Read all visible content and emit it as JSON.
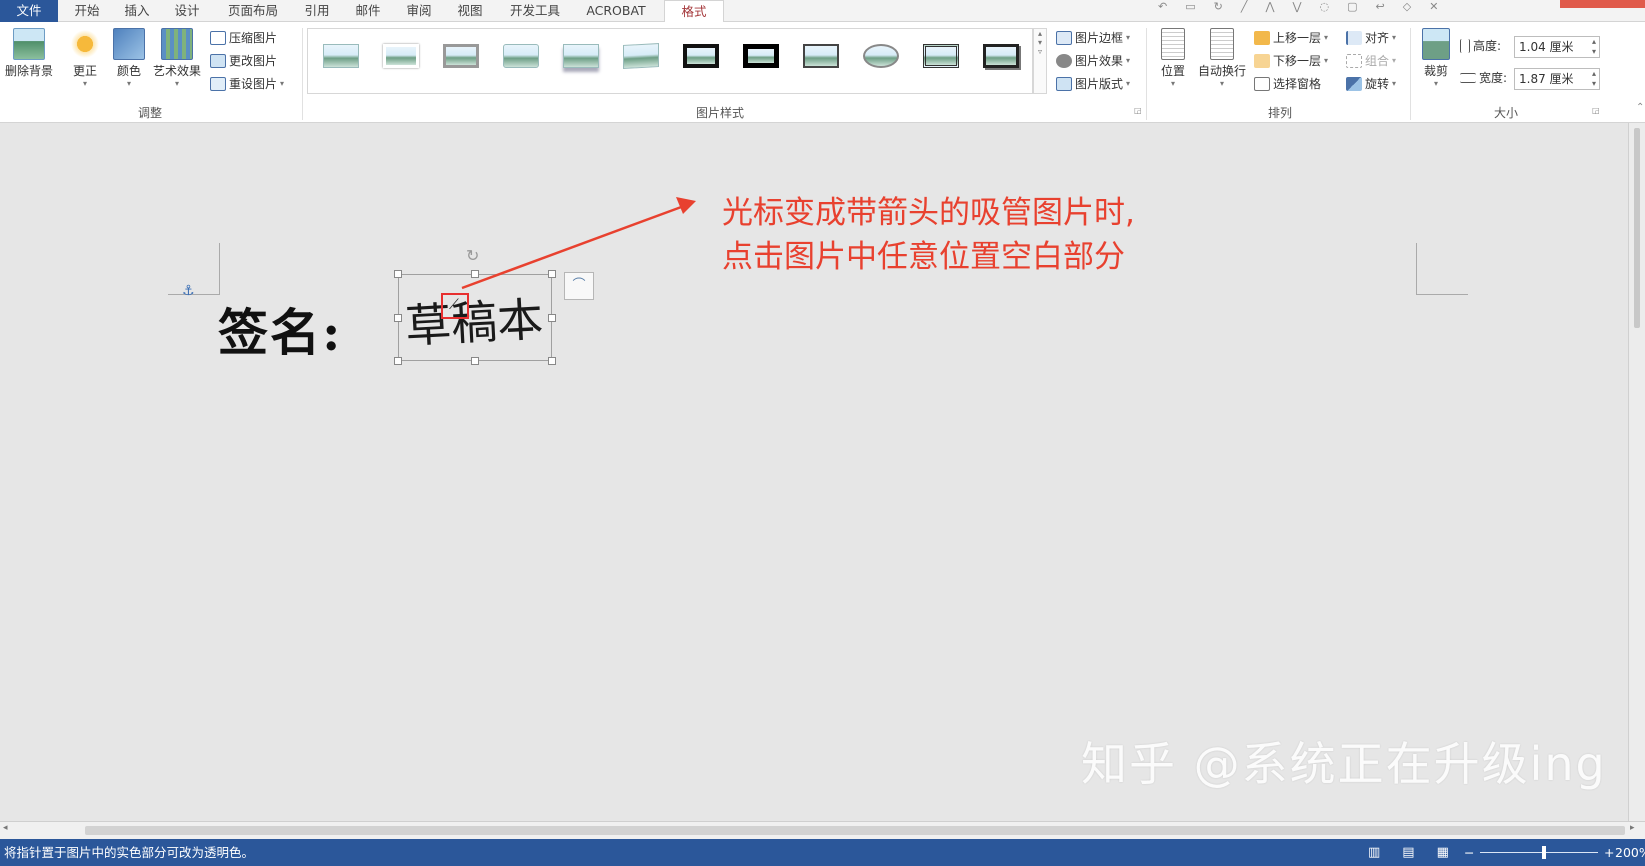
{
  "tabs": {
    "file": "文件",
    "home": "开始",
    "insert": "插入",
    "design": "设计",
    "layout": "页面布局",
    "references": "引用",
    "mailings": "邮件",
    "review": "审阅",
    "view": "视图",
    "developer": "开发工具",
    "acrobat": "ACROBAT",
    "format": "格式"
  },
  "ribbon": {
    "adjust": {
      "label": "调整",
      "remove_bg": "删除背景",
      "corrections": "更正",
      "color": "颜色",
      "artistic": "艺术效果",
      "compress": "压缩图片",
      "change": "更改图片",
      "reset": "重设图片"
    },
    "styles": {
      "label": "图片样式",
      "border": "图片边框",
      "effects": "图片效果",
      "layout": "图片版式"
    },
    "arrange": {
      "label": "排列",
      "position": "位置",
      "wrap": "自动换行",
      "forward": "上移一层",
      "backward": "下移一层",
      "pane": "选择窗格",
      "align": "对齐",
      "group": "组合",
      "rotate": "旋转"
    },
    "size": {
      "label": "大小",
      "crop": "裁剪",
      "height_label": "高度:",
      "height_value": "1.04 厘米",
      "width_label": "宽度:",
      "width_value": "1.87 厘米"
    }
  },
  "document": {
    "signature_label": "签名:",
    "signature_text": "草稿本",
    "annotation_line1": "光标变成带箭头的吸管图片时,",
    "annotation_line2": "点击图片中任意位置空白部分",
    "watermark": "知乎 @系统正在升级ing"
  },
  "status": {
    "message": "将指针置于图片中的实色部分可改为透明色。",
    "zoom": "200%"
  },
  "colors": {
    "accent": "#2b579a",
    "annotation": "#e8412f",
    "format_tab": "#a4373a"
  },
  "icons": {
    "remove_bg": "picture-icon",
    "corrections": "sun-icon",
    "rotate": "rotate-handle-icon",
    "anchor": "anchor-icon",
    "eyedropper": "eyedropper-cursor-icon"
  }
}
